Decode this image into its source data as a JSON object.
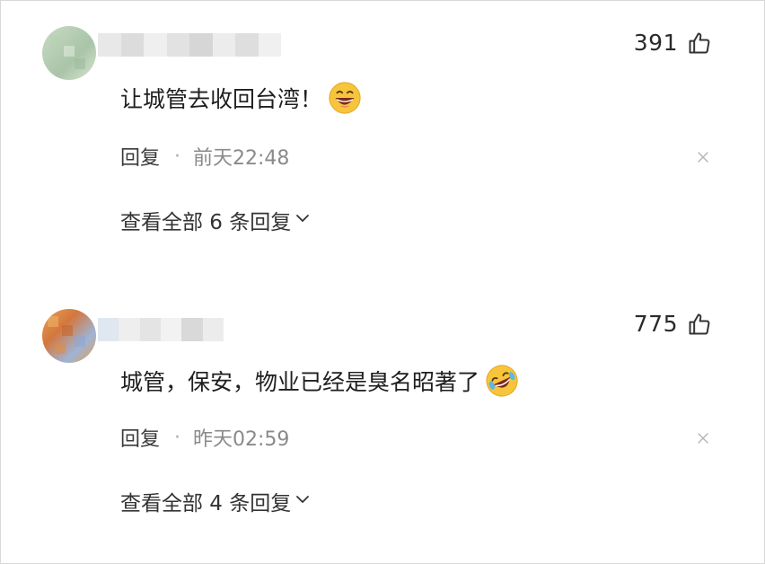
{
  "comments": [
    {
      "likes": "391",
      "text": "让城管去收回台湾！",
      "emoji": "grinning-face",
      "reply_label": "回复",
      "separator": "·",
      "time": "前天22:48",
      "view_replies": "查看全部 6 条回复"
    },
    {
      "likes": "775",
      "text": "城管，保安，物业已经是臭名昭著了",
      "emoji": "rolling-laughing-face",
      "reply_label": "回复",
      "separator": "·",
      "time": "昨天02:59",
      "view_replies": "查看全部 4 条回复"
    }
  ],
  "icons": {
    "like": "thumbs-up-icon",
    "close": "close-icon",
    "expand": "chevron-down-icon"
  },
  "colors": {
    "text": "#1f1f1f",
    "meta": "#8a8a8a",
    "emoji": "#f7c53b"
  }
}
